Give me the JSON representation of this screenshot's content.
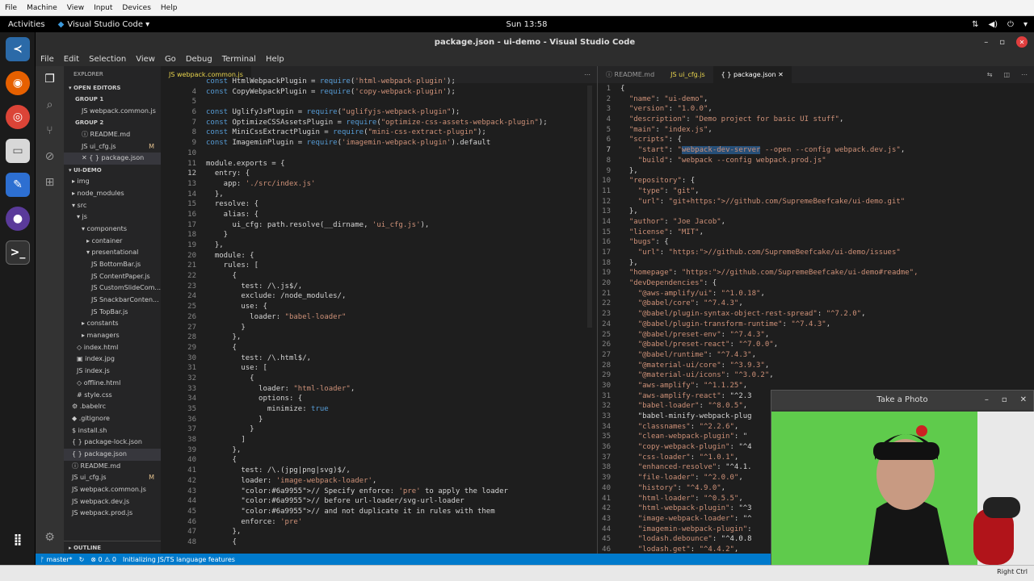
{
  "host": {
    "menu": [
      "File",
      "Machine",
      "View",
      "Input",
      "Devices",
      "Help"
    ],
    "right_ctrl": "Right Ctrl"
  },
  "gnome": {
    "activities": "Activities",
    "app": "Visual Studio Code ▾",
    "clock": "Sun 13:58"
  },
  "window": {
    "title": "package.json - ui-demo - Visual Studio Code"
  },
  "menu": [
    "File",
    "Edit",
    "Selection",
    "View",
    "Go",
    "Debug",
    "Terminal",
    "Help"
  ],
  "explorer": {
    "title": "EXPLORER",
    "open_editors": "▾ OPEN EDITORS",
    "group1": "GROUP 1",
    "group1_files": [
      {
        "name": "JS  webpack.common.js",
        "mod": ""
      }
    ],
    "group2": "GROUP 2",
    "group2_files": [
      {
        "name": "ⓘ README.md",
        "mod": ""
      },
      {
        "name": "JS  ui_cfg.js",
        "mod": "M"
      },
      {
        "name": "✕ { }  package.json",
        "mod": ""
      }
    ],
    "project": "▾ UI-DEMO",
    "tree": [
      {
        "indent": 10,
        "name": "▸ img",
        "mod": ""
      },
      {
        "indent": 10,
        "name": "▸ node_modules",
        "mod": ""
      },
      {
        "indent": 10,
        "name": "▾ src",
        "mod": ""
      },
      {
        "indent": 16,
        "name": "▾ js",
        "mod": ""
      },
      {
        "indent": 22,
        "name": "▾ components",
        "mod": ""
      },
      {
        "indent": 28,
        "name": "▸ container",
        "mod": ""
      },
      {
        "indent": 28,
        "name": "▾ presentational",
        "mod": ""
      },
      {
        "indent": 34,
        "name": "JS BottomBar.js",
        "mod": ""
      },
      {
        "indent": 34,
        "name": "JS ContentPaper.js",
        "mod": ""
      },
      {
        "indent": 34,
        "name": "JS CustomSlideCom...",
        "mod": ""
      },
      {
        "indent": 34,
        "name": "JS SnackbarConten...",
        "mod": ""
      },
      {
        "indent": 34,
        "name": "JS TopBar.js",
        "mod": ""
      },
      {
        "indent": 22,
        "name": "▸ constants",
        "mod": ""
      },
      {
        "indent": 22,
        "name": "▸ managers",
        "mod": ""
      },
      {
        "indent": 16,
        "name": "◇ index.html",
        "mod": ""
      },
      {
        "indent": 16,
        "name": "▣ index.jpg",
        "mod": ""
      },
      {
        "indent": 16,
        "name": "JS index.js",
        "mod": ""
      },
      {
        "indent": 16,
        "name": "◇ offline.html",
        "mod": ""
      },
      {
        "indent": 16,
        "name": "# style.css",
        "mod": ""
      },
      {
        "indent": 10,
        "name": "⚙ .babelrc",
        "mod": ""
      },
      {
        "indent": 10,
        "name": "◆ .gitignore",
        "mod": ""
      },
      {
        "indent": 10,
        "name": "$ install.sh",
        "mod": ""
      },
      {
        "indent": 10,
        "name": "{ } package-lock.json",
        "mod": ""
      },
      {
        "indent": 10,
        "name": "{ } package.json",
        "mod": ""
      },
      {
        "indent": 10,
        "name": "ⓘ README.md",
        "mod": ""
      },
      {
        "indent": 10,
        "name": "JS ui_cfg.js",
        "mod": "M"
      },
      {
        "indent": 10,
        "name": "JS webpack.common.js",
        "mod": ""
      },
      {
        "indent": 10,
        "name": "JS webpack.dev.js",
        "mod": ""
      },
      {
        "indent": 10,
        "name": "JS webpack.prod.js",
        "mod": ""
      }
    ],
    "outline": "▸ OUTLINE"
  },
  "editor1": {
    "tab": "JS  webpack.common.js",
    "lines": [
      [
        "",
        "const HtmlWebpackPlugin = require('html-webpack-plugin');"
      ],
      [
        "4",
        "const CopyWebpackPlugin = require('copy-webpack-plugin');"
      ],
      [
        "5",
        ""
      ],
      [
        "6",
        "const UglifyJsPlugin = require(\"uglifyjs-webpack-plugin\");"
      ],
      [
        "7",
        "const OptimizeCSSAssetsPlugin = require(\"optimize-css-assets-webpack-plugin\");"
      ],
      [
        "8",
        "const MiniCssExtractPlugin = require(\"mini-css-extract-plugin\");"
      ],
      [
        "9",
        "const ImageminPlugin = require('imagemin-webpack-plugin').default"
      ],
      [
        "10",
        ""
      ],
      [
        "11",
        "module.exports = {"
      ],
      [
        "12",
        "  entry: {"
      ],
      [
        "13",
        "    app: './src/index.js'"
      ],
      [
        "14",
        "  },"
      ],
      [
        "15",
        "  resolve: {"
      ],
      [
        "16",
        "    alias: {"
      ],
      [
        "17",
        "      ui_cfg: path.resolve(__dirname, 'ui_cfg.js'),"
      ],
      [
        "18",
        "    }"
      ],
      [
        "19",
        "  },"
      ],
      [
        "20",
        "  module: {"
      ],
      [
        "21",
        "    rules: ["
      ],
      [
        "22",
        "      {"
      ],
      [
        "23",
        "        test: /\\.js$/,"
      ],
      [
        "24",
        "        exclude: /node_modules/,"
      ],
      [
        "25",
        "        use: {"
      ],
      [
        "26",
        "          loader: \"babel-loader\""
      ],
      [
        "27",
        "        }"
      ],
      [
        "28",
        "      },"
      ],
      [
        "29",
        "      {"
      ],
      [
        "30",
        "        test: /\\.html$/,"
      ],
      [
        "31",
        "        use: ["
      ],
      [
        "32",
        "          {"
      ],
      [
        "33",
        "            loader: \"html-loader\","
      ],
      [
        "34",
        "            options: {"
      ],
      [
        "35",
        "              minimize: true"
      ],
      [
        "36",
        "            }"
      ],
      [
        "37",
        "          }"
      ],
      [
        "38",
        "        ]"
      ],
      [
        "39",
        "      },"
      ],
      [
        "40",
        "      {"
      ],
      [
        "41",
        "        test: /\\.(jpg|png|svg)$/,"
      ],
      [
        "42",
        "        loader: 'image-webpack-loader',"
      ],
      [
        "43",
        "        // Specify enforce: 'pre' to apply the loader"
      ],
      [
        "44",
        "        // before url-loader/svg-url-loader"
      ],
      [
        "45",
        "        // and not duplicate it in rules with them"
      ],
      [
        "46",
        "        enforce: 'pre'"
      ],
      [
        "47",
        "      },"
      ],
      [
        "48",
        "      {"
      ]
    ]
  },
  "editor2": {
    "tabs": [
      "ⓘ README.md",
      "JS  ui_cfg.js",
      "{ }  package.json  ✕"
    ],
    "lines": [
      [
        "1",
        "{"
      ],
      [
        "2",
        "  \"name\": \"ui-demo\","
      ],
      [
        "3",
        "  \"version\": \"1.0.0\","
      ],
      [
        "4",
        "  \"description\": \"Demo project for basic UI stuff\","
      ],
      [
        "5",
        "  \"main\": \"index.js\","
      ],
      [
        "6",
        "  \"scripts\": {"
      ],
      [
        "7",
        "    \"start\": \"webpack-dev-server --open --config webpack.dev.js\","
      ],
      [
        "8",
        "    \"build\": \"webpack --config webpack.prod.js\""
      ],
      [
        "9",
        "  },"
      ],
      [
        "10",
        "  \"repository\": {"
      ],
      [
        "11",
        "    \"type\": \"git\","
      ],
      [
        "12",
        "    \"url\": \"git+https://github.com/SupremeBeefcake/ui-demo.git\""
      ],
      [
        "13",
        "  },"
      ],
      [
        "14",
        "  \"author\": \"Joe Jacob\","
      ],
      [
        "15",
        "  \"license\": \"MIT\","
      ],
      [
        "16",
        "  \"bugs\": {"
      ],
      [
        "17",
        "    \"url\": \"https://github.com/SupremeBeefcake/ui-demo/issues\""
      ],
      [
        "18",
        "  },"
      ],
      [
        "19",
        "  \"homepage\": \"https://github.com/SupremeBeefcake/ui-demo#readme\","
      ],
      [
        "20",
        "  \"devDependencies\": {"
      ],
      [
        "21",
        "    \"@aws-amplify/ui\": \"^1.0.18\","
      ],
      [
        "22",
        "    \"@babel/core\": \"^7.4.3\","
      ],
      [
        "23",
        "    \"@babel/plugin-syntax-object-rest-spread\": \"^7.2.0\","
      ],
      [
        "24",
        "    \"@babel/plugin-transform-runtime\": \"^7.4.3\","
      ],
      [
        "25",
        "    \"@babel/preset-env\": \"^7.4.3\","
      ],
      [
        "26",
        "    \"@babel/preset-react\": \"^7.0.0\","
      ],
      [
        "27",
        "    \"@babel/runtime\": \"^7.4.3\","
      ],
      [
        "28",
        "    \"@material-ui/core\": \"^3.9.3\","
      ],
      [
        "29",
        "    \"@material-ui/icons\": \"^3.0.2\","
      ],
      [
        "30",
        "    \"aws-amplify\": \"^1.1.25\","
      ],
      [
        "31",
        "    \"aws-amplify-react\": \"^2.3"
      ],
      [
        "32",
        "    \"babel-loader\": \"^8.0.5\","
      ],
      [
        "33",
        "    \"babel-minify-webpack-plug"
      ],
      [
        "34",
        "    \"classnames\": \"^2.2.6\","
      ],
      [
        "35",
        "    \"clean-webpack-plugin\": \""
      ],
      [
        "36",
        "    \"copy-webpack-plugin\": \"^4"
      ],
      [
        "37",
        "    \"css-loader\": \"^1.0.1\","
      ],
      [
        "38",
        "    \"enhanced-resolve\": \"^4.1."
      ],
      [
        "39",
        "    \"file-loader\": \"^2.0.0\","
      ],
      [
        "40",
        "    \"history\": \"^4.9.0\","
      ],
      [
        "41",
        "    \"html-loader\": \"^0.5.5\","
      ],
      [
        "42",
        "    \"html-webpack-plugin\": \"^3"
      ],
      [
        "43",
        "    \"image-webpack-loader\": \"^"
      ],
      [
        "44",
        "    \"imagemin-webpack-plugin\": "
      ],
      [
        "45",
        "    \"lodash.debounce\": \"^4.0.8"
      ],
      [
        "46",
        "    \"lodash.get\": \"^4.4.2\","
      ]
    ]
  },
  "status": {
    "branch": "ᚠ master*",
    "errors": "⊗ 0  ⚠ 0",
    "message": "Initializing JS/TS language features"
  },
  "photo": {
    "title": "Take a Photo"
  }
}
